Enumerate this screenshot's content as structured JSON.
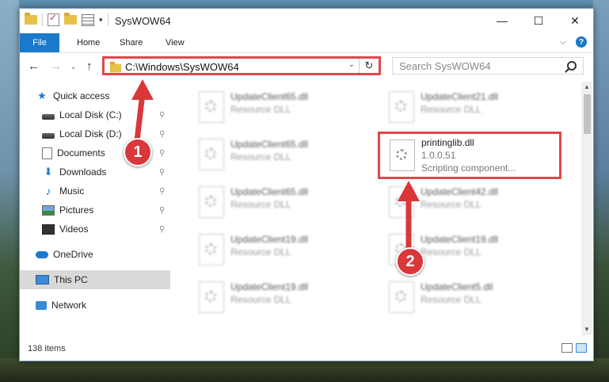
{
  "window": {
    "title": "SysWOW64"
  },
  "controls": {
    "minimize": "—",
    "maximize": "☐",
    "close": "✕"
  },
  "ribbon": {
    "tabs": [
      "File",
      "Home",
      "Share",
      "View"
    ],
    "expand_glyph": "⌵",
    "help": "?"
  },
  "nav": {
    "back": "←",
    "forward": "→",
    "recent": "⌄",
    "up": "↑"
  },
  "address": {
    "path": "C:\\Windows\\SysWOW64",
    "dropdown": "⌄",
    "refresh": "↻"
  },
  "search": {
    "placeholder": "Search SysWOW64"
  },
  "sidebar": {
    "items": [
      {
        "label": "Quick access",
        "icon": "star-icon"
      },
      {
        "label": "Local Disk (C:)",
        "icon": "disk-icon",
        "pinned": true
      },
      {
        "label": "Local Disk (D:)",
        "icon": "disk-icon",
        "pinned": true
      },
      {
        "label": "Documents",
        "icon": "documents-icon",
        "pinned": true
      },
      {
        "label": "Downloads",
        "icon": "download-icon",
        "pinned": true
      },
      {
        "label": "Music",
        "icon": "music-icon",
        "pinned": true
      },
      {
        "label": "Pictures",
        "icon": "pictures-icon",
        "pinned": true
      },
      {
        "label": "Videos",
        "icon": "videos-icon",
        "pinned": true
      },
      {
        "label": "OneDrive",
        "icon": "cloud-icon"
      },
      {
        "label": "This PC",
        "icon": "computer-icon",
        "selected": true
      },
      {
        "label": "Network",
        "icon": "network-icon"
      }
    ],
    "pin_glyph": "📌"
  },
  "files": [
    {
      "name": "UpdateClient65.dll",
      "type": "Resource DLL"
    },
    {
      "name": "UpdateClient21.dll",
      "type": "Resource DLL"
    },
    {
      "name": "UpdateClient65.dll",
      "type": "Resource DLL"
    },
    {
      "name": "printinglib.dll",
      "version": "1.0.0.51",
      "type": "Scripting component...",
      "highlighted": true
    },
    {
      "name": "UpdateClient65.dll",
      "type": "Resource DLL"
    },
    {
      "name": "UpdateClient42.dll",
      "type": "Resource DLL"
    },
    {
      "name": "UpdateClient19.dll",
      "type": "Resource DLL"
    },
    {
      "name": "UpdateClient19.dll",
      "type": "Resource DLL"
    },
    {
      "name": "UpdateClient19.dll",
      "type": "Resource DLL"
    },
    {
      "name": "UpdateClient5.dll",
      "type": "Resource DLL"
    }
  ],
  "status": {
    "item_count": "138 items"
  },
  "annotations": [
    {
      "label": "1",
      "color": "#d9373a"
    },
    {
      "label": "2",
      "color": "#d9373a"
    }
  ],
  "colors": {
    "accent": "#1979ca",
    "highlight": "#e1474a"
  }
}
